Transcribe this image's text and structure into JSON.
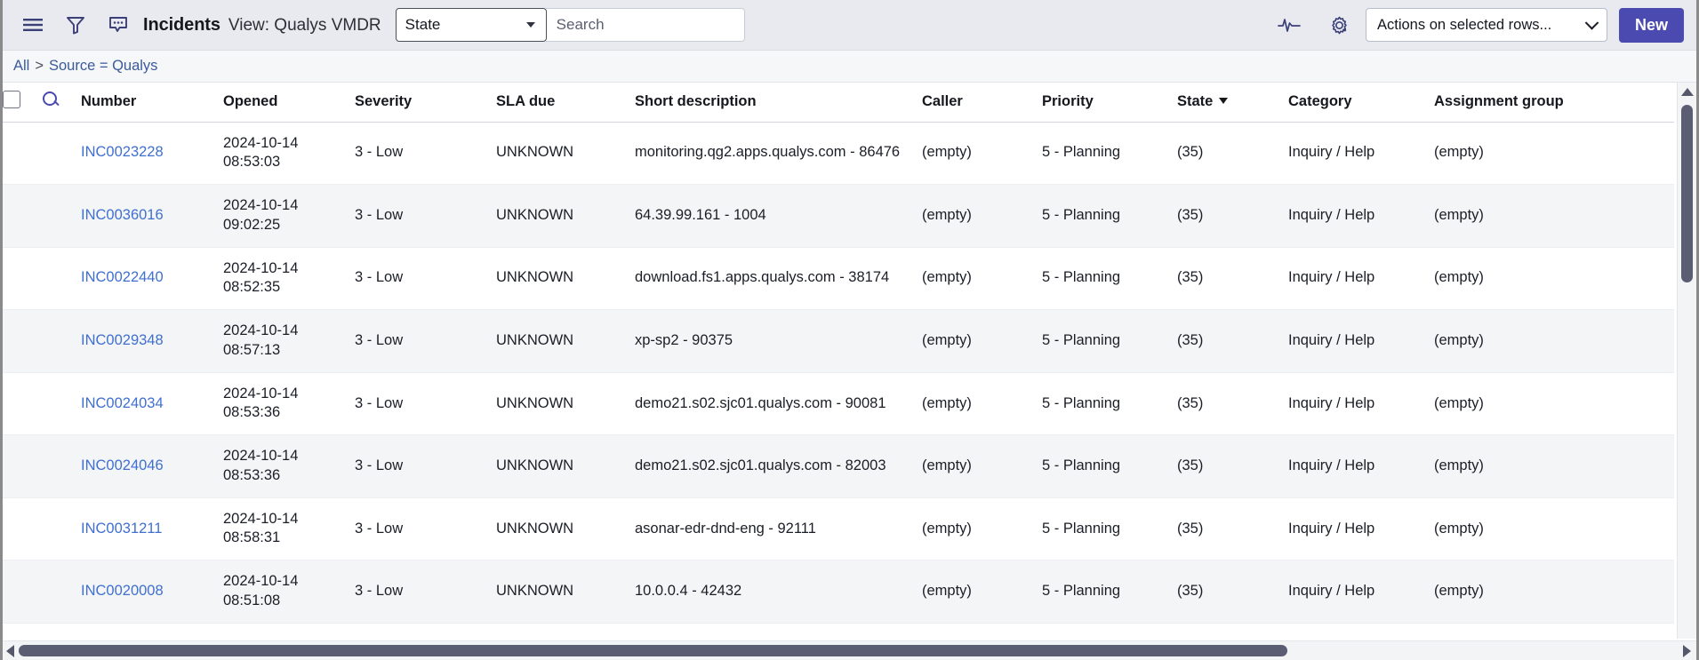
{
  "toolbar": {
    "menu_icon": "hamburger-menu-icon",
    "filter_icon": "filter-funnel-icon",
    "comment_icon": "comment-bubble-icon",
    "app_title": "Incidents",
    "view_label": "View: Qualys VMDR",
    "state_filter_value": "State",
    "search_placeholder": "Search",
    "search_value": "",
    "activity_icon": "activity-pulse-icon",
    "settings_icon": "gear-icon",
    "actions_value": "Actions on selected rows...",
    "new_label": "New",
    "accent_color": "#4a4ab0",
    "toolbar_bg": "#e8eaef"
  },
  "breadcrumb": {
    "root": "All",
    "separator": ">",
    "current": "Source = Qualys"
  },
  "table": {
    "select_all_checkbox": "",
    "search_row_icon": "magnifier-icon",
    "columns": [
      "Number",
      "Opened",
      "Severity",
      "SLA due",
      "Short description",
      "Caller",
      "Priority",
      "State",
      "Category",
      "Assignment group"
    ],
    "sorted_column": "State",
    "sort_direction": "desc",
    "rows": [
      {
        "number": "INC0023228",
        "opened": "2024-10-14 08:53:03",
        "severity": "3 - Low",
        "sla_due": "UNKNOWN",
        "short_description": "monitoring.qg2.apps.qualys.com - 86476",
        "caller": "(empty)",
        "priority": "5 - Planning",
        "state": "(35)",
        "category": "Inquiry / Help",
        "assignment_group": "(empty)"
      },
      {
        "number": "INC0036016",
        "opened": "2024-10-14 09:02:25",
        "severity": "3 - Low",
        "sla_due": "UNKNOWN",
        "short_description": "64.39.99.161 - 1004",
        "caller": "(empty)",
        "priority": "5 - Planning",
        "state": "(35)",
        "category": "Inquiry / Help",
        "assignment_group": "(empty)"
      },
      {
        "number": "INC0022440",
        "opened": "2024-10-14 08:52:35",
        "severity": "3 - Low",
        "sla_due": "UNKNOWN",
        "short_description": "download.fs1.apps.qualys.com - 38174",
        "caller": "(empty)",
        "priority": "5 - Planning",
        "state": "(35)",
        "category": "Inquiry / Help",
        "assignment_group": "(empty)"
      },
      {
        "number": "INC0029348",
        "opened": "2024-10-14 08:57:13",
        "severity": "3 - Low",
        "sla_due": "UNKNOWN",
        "short_description": "xp-sp2 - 90375",
        "caller": "(empty)",
        "priority": "5 - Planning",
        "state": "(35)",
        "category": "Inquiry / Help",
        "assignment_group": "(empty)"
      },
      {
        "number": "INC0024034",
        "opened": "2024-10-14 08:53:36",
        "severity": "3 - Low",
        "sla_due": "UNKNOWN",
        "short_description": "demo21.s02.sjc01.qualys.com - 90081",
        "caller": "(empty)",
        "priority": "5 - Planning",
        "state": "(35)",
        "category": "Inquiry / Help",
        "assignment_group": "(empty)"
      },
      {
        "number": "INC0024046",
        "opened": "2024-10-14 08:53:36",
        "severity": "3 - Low",
        "sla_due": "UNKNOWN",
        "short_description": "demo21.s02.sjc01.qualys.com - 82003",
        "caller": "(empty)",
        "priority": "5 - Planning",
        "state": "(35)",
        "category": "Inquiry / Help",
        "assignment_group": "(empty)"
      },
      {
        "number": "INC0031211",
        "opened": "2024-10-14 08:58:31",
        "severity": "3 - Low",
        "sla_due": "UNKNOWN",
        "short_description": "asonar-edr-dnd-eng - 92111",
        "caller": "(empty)",
        "priority": "5 - Planning",
        "state": "(35)",
        "category": "Inquiry / Help",
        "assignment_group": "(empty)"
      },
      {
        "number": "INC0020008",
        "opened": "2024-10-14 08:51:08",
        "severity": "3 - Low",
        "sla_due": "UNKNOWN",
        "short_description": "10.0.0.4 - 42432",
        "caller": "(empty)",
        "priority": "5 - Planning",
        "state": "(35)",
        "category": "Inquiry / Help",
        "assignment_group": "(empty)"
      }
    ]
  }
}
